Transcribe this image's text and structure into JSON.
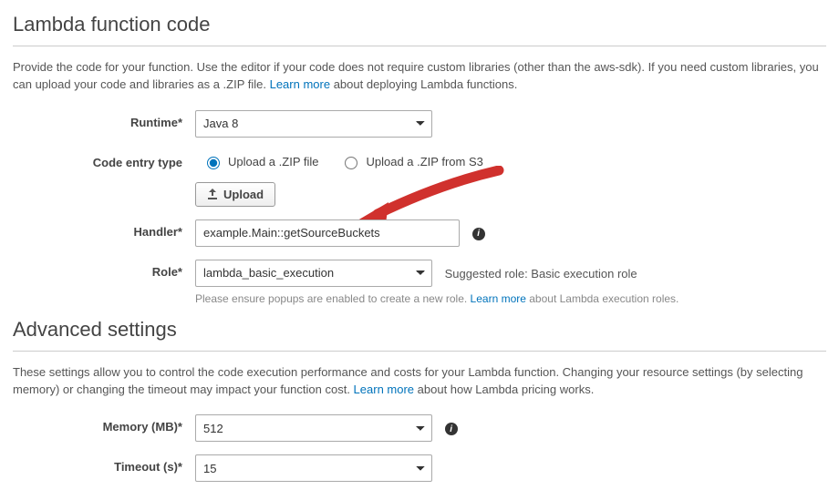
{
  "section1": {
    "title": "Lambda function code",
    "desc_before": "Provide the code for your function. Use the editor if your code does not require custom libraries (other than the aws-sdk). If you need custom libraries, you can upload your code and libraries as a .ZIP file. ",
    "learn_more": "Learn more",
    "desc_after": " about deploying Lambda functions."
  },
  "form": {
    "runtime_label": "Runtime*",
    "runtime_value": "Java 8",
    "entry_label": "Code entry type",
    "entry_options": {
      "zip": "Upload a .ZIP file",
      "s3": "Upload a .ZIP from S3"
    },
    "entry_selected": "zip",
    "upload_button": "Upload",
    "handler_label": "Handler*",
    "handler_value": "example.Main::getSourceBuckets",
    "role_label": "Role*",
    "role_value": "lambda_basic_execution",
    "role_suggested": "Suggested role: Basic execution role",
    "role_hint_before": "Please ensure popups are enabled to create a new role. ",
    "role_hint_link": "Learn more",
    "role_hint_after": " about Lambda execution roles."
  },
  "section2": {
    "title": "Advanced settings",
    "desc_before": "These settings allow you to control the code execution performance and costs for your Lambda function. Changing your resource settings (by selecting memory) or changing the timeout may impact your function cost. ",
    "learn_more": "Learn more",
    "desc_after": " about how Lambda pricing works."
  },
  "adv": {
    "memory_label": "Memory (MB)*",
    "memory_value": "512",
    "timeout_label": "Timeout (s)*",
    "timeout_value": "15"
  },
  "info_glyph": "i"
}
